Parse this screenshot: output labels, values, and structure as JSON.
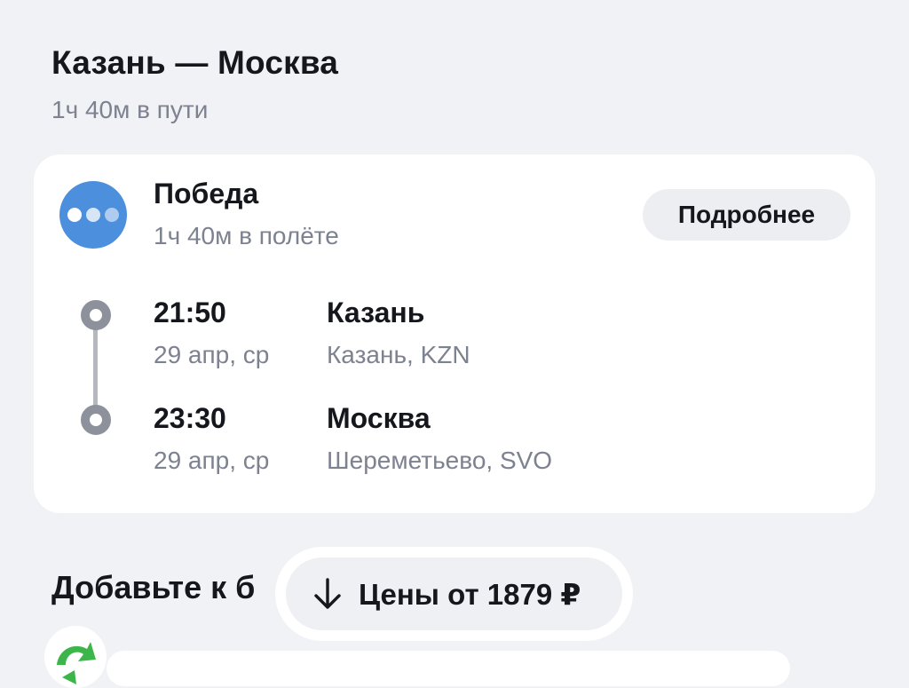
{
  "route": {
    "title": "Казань — Москва",
    "duration": "1ч 40м в пути"
  },
  "flight": {
    "airline": "Победа",
    "duration": "1ч 40м в полёте",
    "details_label": "Подробнее",
    "segments": [
      {
        "time": "21:50",
        "date": "29 апр, ср",
        "city": "Казань",
        "airport": "Казань, KZN"
      },
      {
        "time": "23:30",
        "date": "29 апр, ср",
        "city": "Москва",
        "airport": "Шереметьево, SVO"
      }
    ]
  },
  "addons": {
    "heading": "Добавьте к б"
  },
  "prices_button": {
    "label": "Цены от 1879 ₽",
    "icon": "arrow-down-icon"
  },
  "colors": {
    "background": "#f1f2f5",
    "card": "#ffffff",
    "airline_logo": "#4c8fdc",
    "muted_text": "#7d8290",
    "timeline": "#8c919b",
    "button_bg": "#eceef2",
    "promo_icon": "#3cb64a"
  }
}
